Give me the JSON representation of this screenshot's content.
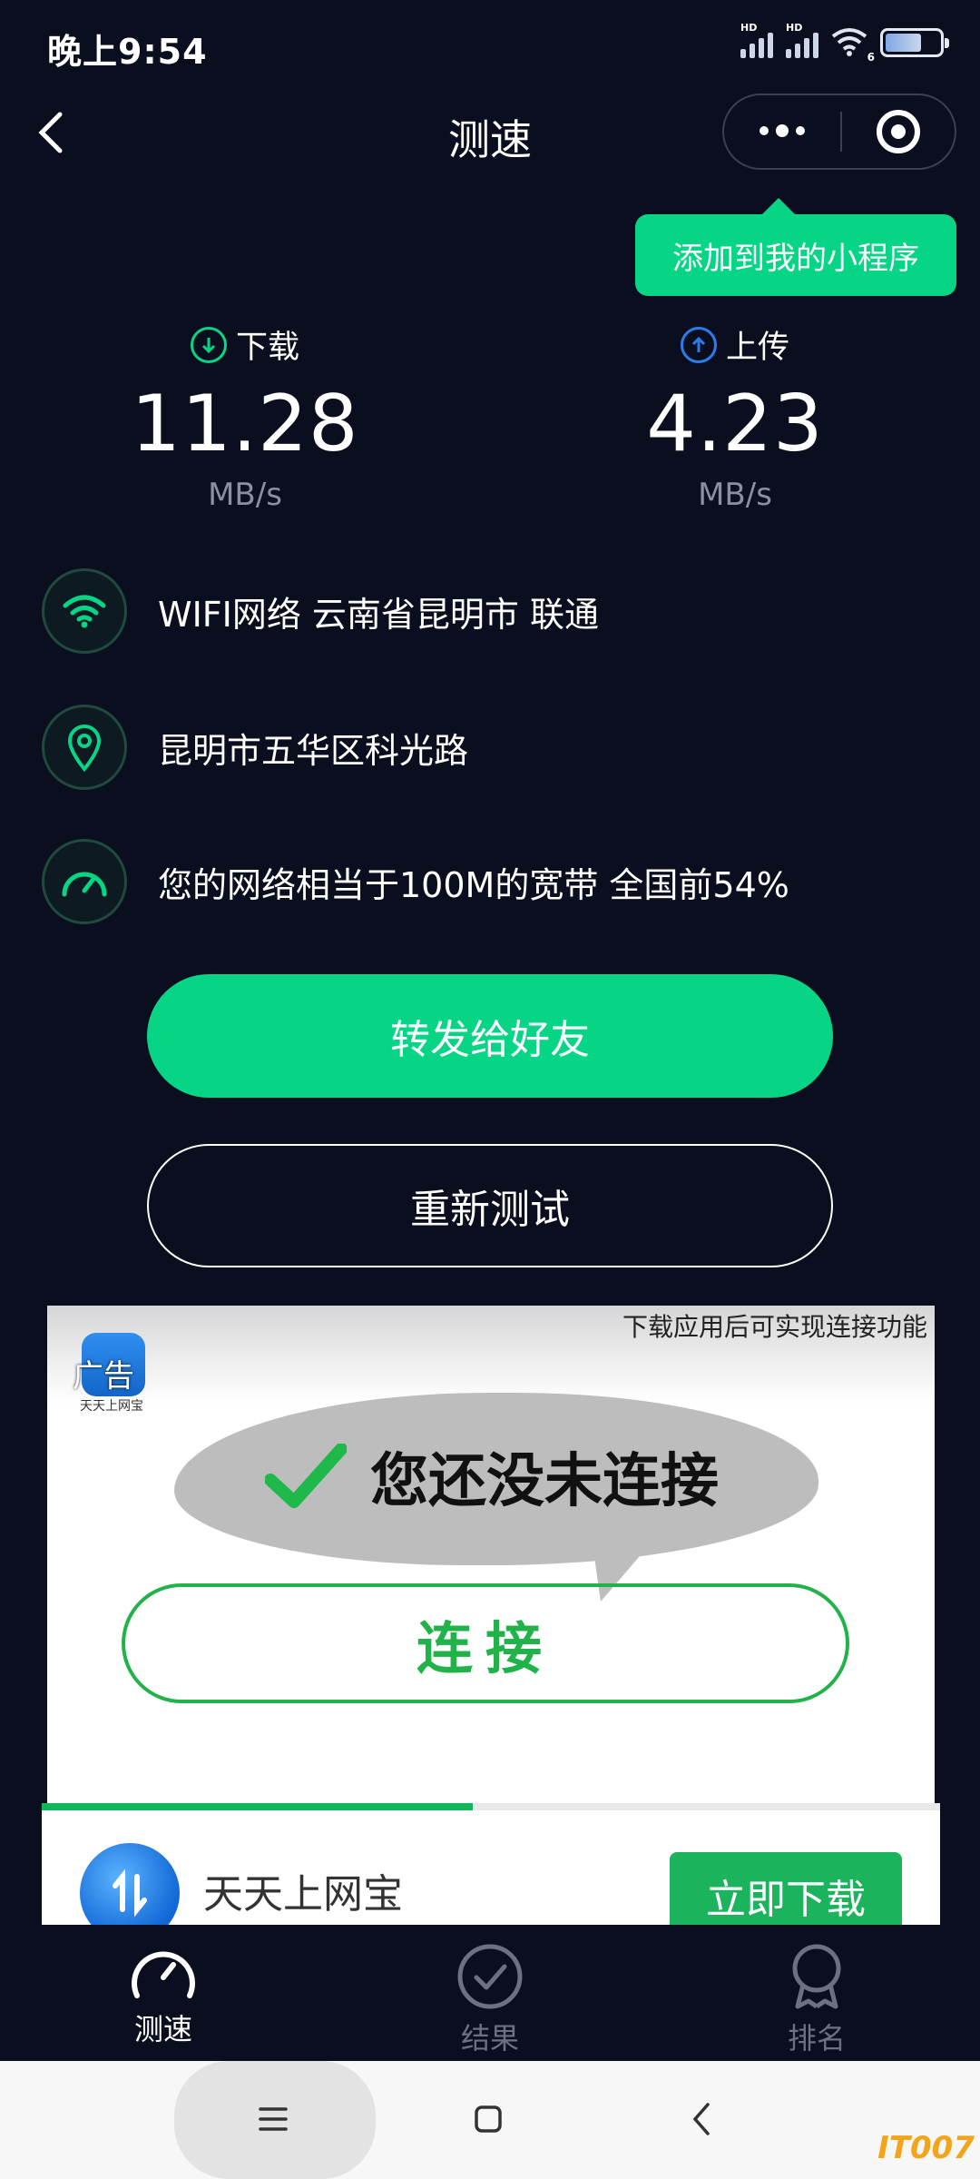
{
  "status_bar": {
    "time": "晚上9:54",
    "hd_label": "HD",
    "wifi_badge": "6"
  },
  "nav": {
    "title": "测速"
  },
  "tooltip": {
    "text": "添加到我的小程序"
  },
  "download": {
    "label": "下载",
    "value": "11.28",
    "unit": "MB/s"
  },
  "upload": {
    "label": "上传",
    "value": "4.23",
    "unit": "MB/s"
  },
  "info": {
    "network": "WIFI网络 云南省昆明市 联通",
    "location": "昆明市五华区科光路",
    "bandwidth": "您的网络相当于100M的宽带 全国前54%"
  },
  "buttons": {
    "share": "转发给好友",
    "retest": "重新测试"
  },
  "ad": {
    "tip": "下载应用后可实现连接功能",
    "tag": "广告",
    "logo_caption": "天天上网宝",
    "message": "您还没未连接",
    "connect": "连接",
    "progress": 0.48,
    "app_name": "天天上网宝",
    "download_button": "立即下载"
  },
  "tabs": [
    {
      "label": "测速",
      "icon": "gauge-icon",
      "active": true
    },
    {
      "label": "结果",
      "icon": "check-circle-icon",
      "active": false
    },
    {
      "label": "排名",
      "icon": "ribbon-icon",
      "active": false
    }
  ],
  "watermark": "IT007",
  "colors": {
    "background": "#0b0e1e",
    "accent": "#07d586",
    "ad_green": "#22b24a",
    "upload_blue": "#2b7de9"
  }
}
